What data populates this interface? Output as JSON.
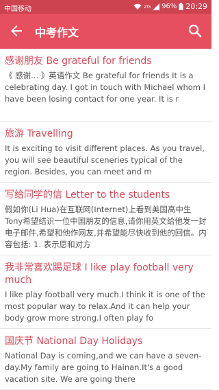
{
  "status": {
    "carrier": "中国移动",
    "network": "2G",
    "battery": "96%",
    "time": "20:29"
  },
  "appbar": {
    "title": "中考作文"
  },
  "articles": [
    {
      "title": "感谢朋友 Be grateful for friends",
      "excerpt": "《 感谢... 》英语作文 Be grateful for friends It is a celebrating day. I got in touch with Michael whom I have been losing contact for one year. It is r"
    },
    {
      "title": "旅游 Travelling",
      "excerpt": "It is exciting to visit different places. As you travel, you will see beautiful sceneries typical of the region. Besides, you can meet and m"
    },
    {
      "title": "写给同学的信 Letter to the students",
      "excerpt": "假如你(Li Hua)在互联网(Internet)上看到美国高中生Tony希望结识一位中国朋友的信息,请你用英文给他发一封电子邮件,希望和他作网友,并希望能尽快收到他的回信。内容包括: 1. 表示愿和对方"
    },
    {
      "title": "我非常喜欢踢足球 I like play football very much",
      "excerpt": "I like play football very much.I think it is one of the most popular way to relax.And it can help your body grow more strong.I often play fo"
    },
    {
      "title": "国庆节 National Day Holidays",
      "excerpt": "National Day is coming,and we can have a seven-day.My family are going to Hainan.It's a good vacation site. We are going there"
    }
  ]
}
